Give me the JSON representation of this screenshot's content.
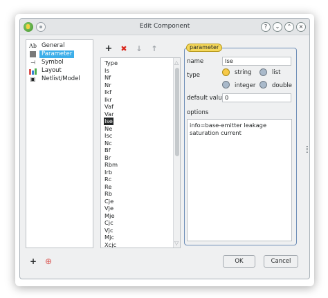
{
  "window": {
    "title": "Edit Component"
  },
  "titlebar_buttons": {
    "help": "?",
    "minimize": "⌄",
    "maximize": "⌃",
    "close": "×"
  },
  "nav": {
    "items": [
      {
        "label": "General",
        "icon": "general-icon",
        "icon_text": "Ab",
        "selected": false
      },
      {
        "label": "Parameter",
        "icon": "parameter-icon",
        "icon_text": "",
        "selected": true
      },
      {
        "label": "Symbol",
        "icon": "symbol-icon",
        "icon_text": "⊣",
        "selected": false
      },
      {
        "label": "Layout",
        "icon": "layout-icon",
        "icon_text": "",
        "selected": false
      },
      {
        "label": "Netlist/Model",
        "icon": "netlist-icon",
        "icon_text": "▣",
        "selected": false
      }
    ]
  },
  "list_toolbar": {
    "add": "+",
    "remove": "✖",
    "move_down": "↓",
    "move_up": "↑"
  },
  "param_list": {
    "items": [
      "Type",
      "Is",
      "Nf",
      "Nr",
      "Ikf",
      "Ikr",
      "Vaf",
      "Var",
      "Ise",
      "Ne",
      "Isc",
      "Nc",
      "Bf",
      "Br",
      "Rbm",
      "Irb",
      "Rc",
      "Re",
      "Rb",
      "Cje",
      "Vje",
      "Mje",
      "Cjc",
      "Vjc",
      "Mjc",
      "Xcjc"
    ],
    "selected": "Ise"
  },
  "parameter": {
    "group_title": "parameter",
    "name_label": "name",
    "name_value": "Ise",
    "type_label": "type",
    "types": [
      {
        "label": "string",
        "checked": true
      },
      {
        "label": "list",
        "checked": false
      },
      {
        "label": "integer",
        "checked": false
      },
      {
        "label": "double",
        "checked": false
      }
    ],
    "default_label": "default value",
    "default_value": "0",
    "options_label": "options",
    "options_text": "info=base-emitter leakage saturation current"
  },
  "bottom": {
    "ok": "OK",
    "cancel": "Cancel",
    "add_icon": "+",
    "help_icon": "⊕"
  },
  "colors": {
    "selection": "#3daee9",
    "group_border": "#6f8fb8",
    "group_title_bg": "#f5d85a",
    "radio_checked": "#f7c948"
  }
}
